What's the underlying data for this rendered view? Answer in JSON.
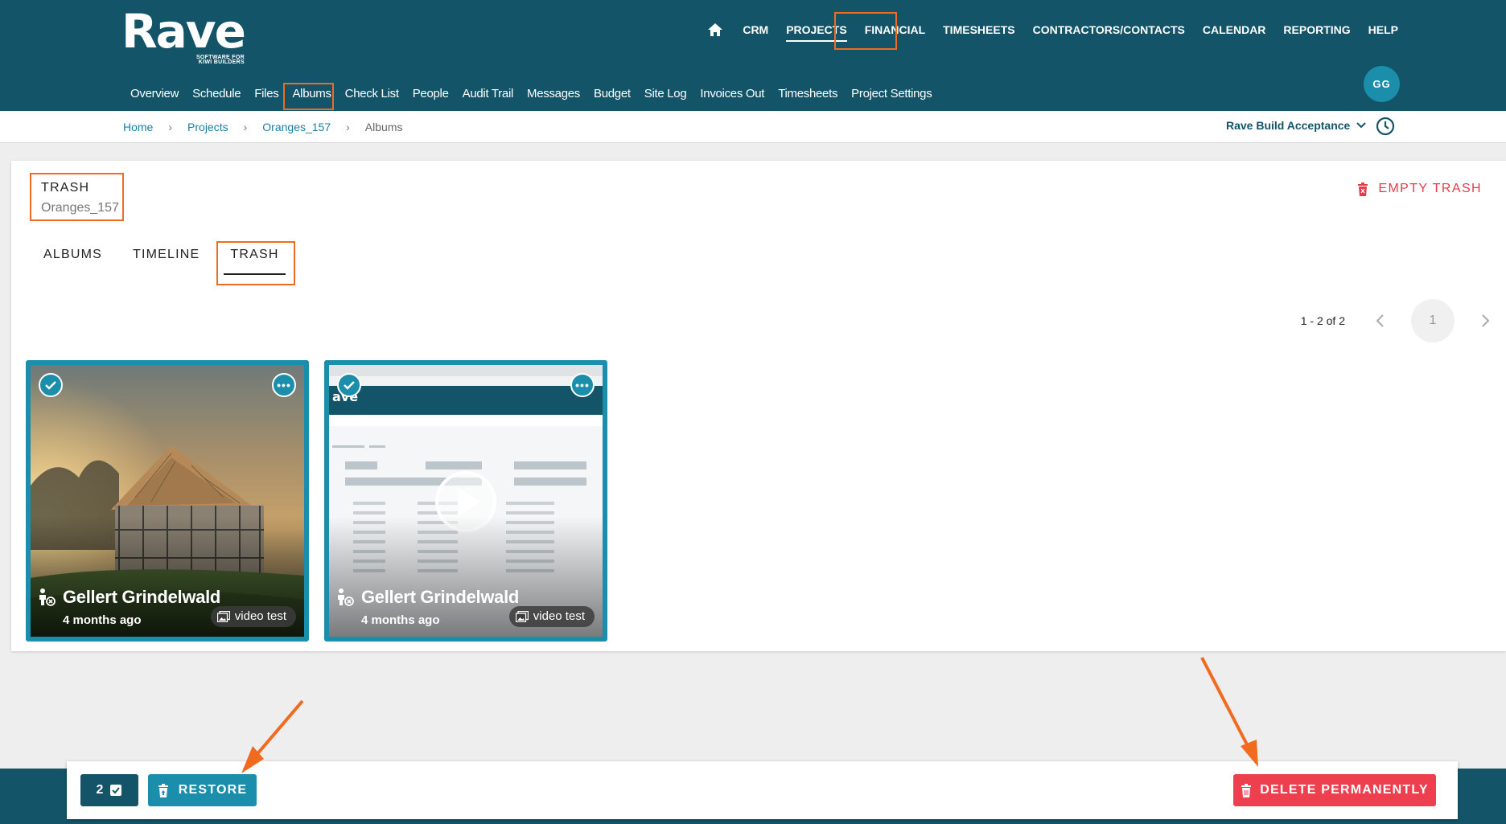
{
  "app": {
    "logo_word": "Rave",
    "logo_tagline_1": "SOFTWARE FOR",
    "logo_tagline_2": "KIWI BUILDERS"
  },
  "topnav": {
    "items": [
      "CRM",
      "PROJECTS",
      "FINANCIAL",
      "TIMESHEETS",
      "CONTRACTORS/CONTACTS",
      "CALENDAR",
      "REPORTING",
      "HELP"
    ],
    "active": "PROJECTS"
  },
  "subnav": {
    "items": [
      "Overview",
      "Schedule",
      "Files",
      "Albums",
      "Check List",
      "People",
      "Audit Trail",
      "Messages",
      "Budget",
      "Site Log",
      "Invoices Out",
      "Timesheets",
      "Project Settings"
    ],
    "active": "Albums"
  },
  "user": {
    "initials": "GG"
  },
  "breadcrumb": [
    "Home",
    "Projects",
    "Oranges_157",
    "Albums"
  ],
  "organization": "Rave Build Acceptance",
  "page": {
    "title": "TRASH",
    "subtitle": "Oranges_157",
    "empty_trash_label": "EMPTY TRASH"
  },
  "tabs": [
    "ALBUMS",
    "TIMELINE",
    "TRASH"
  ],
  "active_tab": "TRASH",
  "pagination": {
    "range": "1 - 2 of 2",
    "current_page": "1"
  },
  "items": [
    {
      "type": "photo",
      "uploader": "Gellert Grindelwald",
      "time": "4 months ago",
      "album": "video test",
      "selected": true
    },
    {
      "type": "video",
      "uploader": "Gellert Grindelwald",
      "time": "4 months ago",
      "album": "video test",
      "selected": true
    }
  ],
  "actions": {
    "selected_count": "2",
    "restore_label": "RESTORE",
    "delete_label": "DELETE PERMANENTLY"
  },
  "colors": {
    "brand_dark": "#135468",
    "accent": "#1a8eaa",
    "danger": "#ee3f4e",
    "highlight": "#f06a20"
  }
}
